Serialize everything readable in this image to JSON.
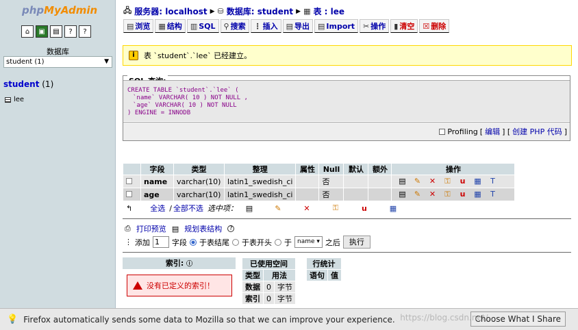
{
  "sidebar": {
    "logo_php": "php",
    "logo_admin": "MyAdmin",
    "db_label": "数据库",
    "db_select": "student (1)",
    "db_name": "student",
    "db_count": " (1)",
    "table_name": "lee"
  },
  "breadcrumb": {
    "server_label": "服务器: localhost",
    "db_label": "数据库: student",
    "table_label": "表 : lee"
  },
  "tabs": [
    {
      "label": "浏览",
      "icon": "browse-icon"
    },
    {
      "label": "结构",
      "icon": "structure-icon"
    },
    {
      "label": "SQL",
      "icon": "sql-icon"
    },
    {
      "label": "搜索",
      "icon": "search-icon"
    },
    {
      "label": "插入",
      "icon": "insert-icon"
    },
    {
      "label": "导出",
      "icon": "export-icon"
    },
    {
      "label": "Import",
      "icon": "import-icon"
    },
    {
      "label": "操作",
      "icon": "operations-icon"
    },
    {
      "label": "清空",
      "icon": "empty-icon"
    },
    {
      "label": "删除",
      "icon": "drop-icon"
    }
  ],
  "notice": "表 `student`.`lee` 已经建立。",
  "sql": {
    "legend": "SQL 查询:",
    "line1": "CREATE TABLE `student`.`lee` (",
    "line2": "`name` VARCHAR( 10 ) NOT NULL ,",
    "line3": "`age` VARCHAR( 10 ) NOT NULL",
    "line4": ") ENGINE = INNODB",
    "profiling": "Profiling",
    "edit": "编辑",
    "create_php": "创建 PHP 代码"
  },
  "structure": {
    "headers": [
      "字段",
      "类型",
      "整理",
      "属性",
      "Null",
      "默认",
      "额外",
      "操作"
    ],
    "rows": [
      {
        "field": "name",
        "type": "varchar(10)",
        "collation": "latin1_swedish_ci",
        "attr": "",
        "null": "否",
        "default": "",
        "extra": ""
      },
      {
        "field": "age",
        "type": "varchar(10)",
        "collation": "latin1_swedish_ci",
        "attr": "",
        "null": "否",
        "default": "",
        "extra": ""
      }
    ],
    "select_all": "全选",
    "deselect_all": "全部不选",
    "with_selected": "选中项："
  },
  "print_view": "打印预览",
  "propose_structure": "规划表结构",
  "add_field": {
    "add": "添加",
    "count": "1",
    "field": "字段",
    "at_end": "于表结尾",
    "at_start": "于表开头",
    "at": "于",
    "after_select": "name",
    "after": "之后",
    "go": "执行"
  },
  "indexes": {
    "title": "索引:",
    "none": "没有已定义的索引！"
  },
  "space": {
    "title": "已使用空间",
    "h_type": "类型",
    "h_usage": "用法",
    "r1_type": "数据",
    "r1_val": "0",
    "r1_unit": "字节",
    "r2_type": "索引",
    "r2_val": "0",
    "r2_unit": "字节"
  },
  "rowstats": {
    "title": "行统计",
    "h_stmt": "语句",
    "h_val": "值"
  },
  "notification": {
    "text": "Firefox automatically sends some data to Mozilla so that we can improve your experience.",
    "button": "Choose What I Share"
  },
  "watermark": "https://blog.csdn.net/..."
}
